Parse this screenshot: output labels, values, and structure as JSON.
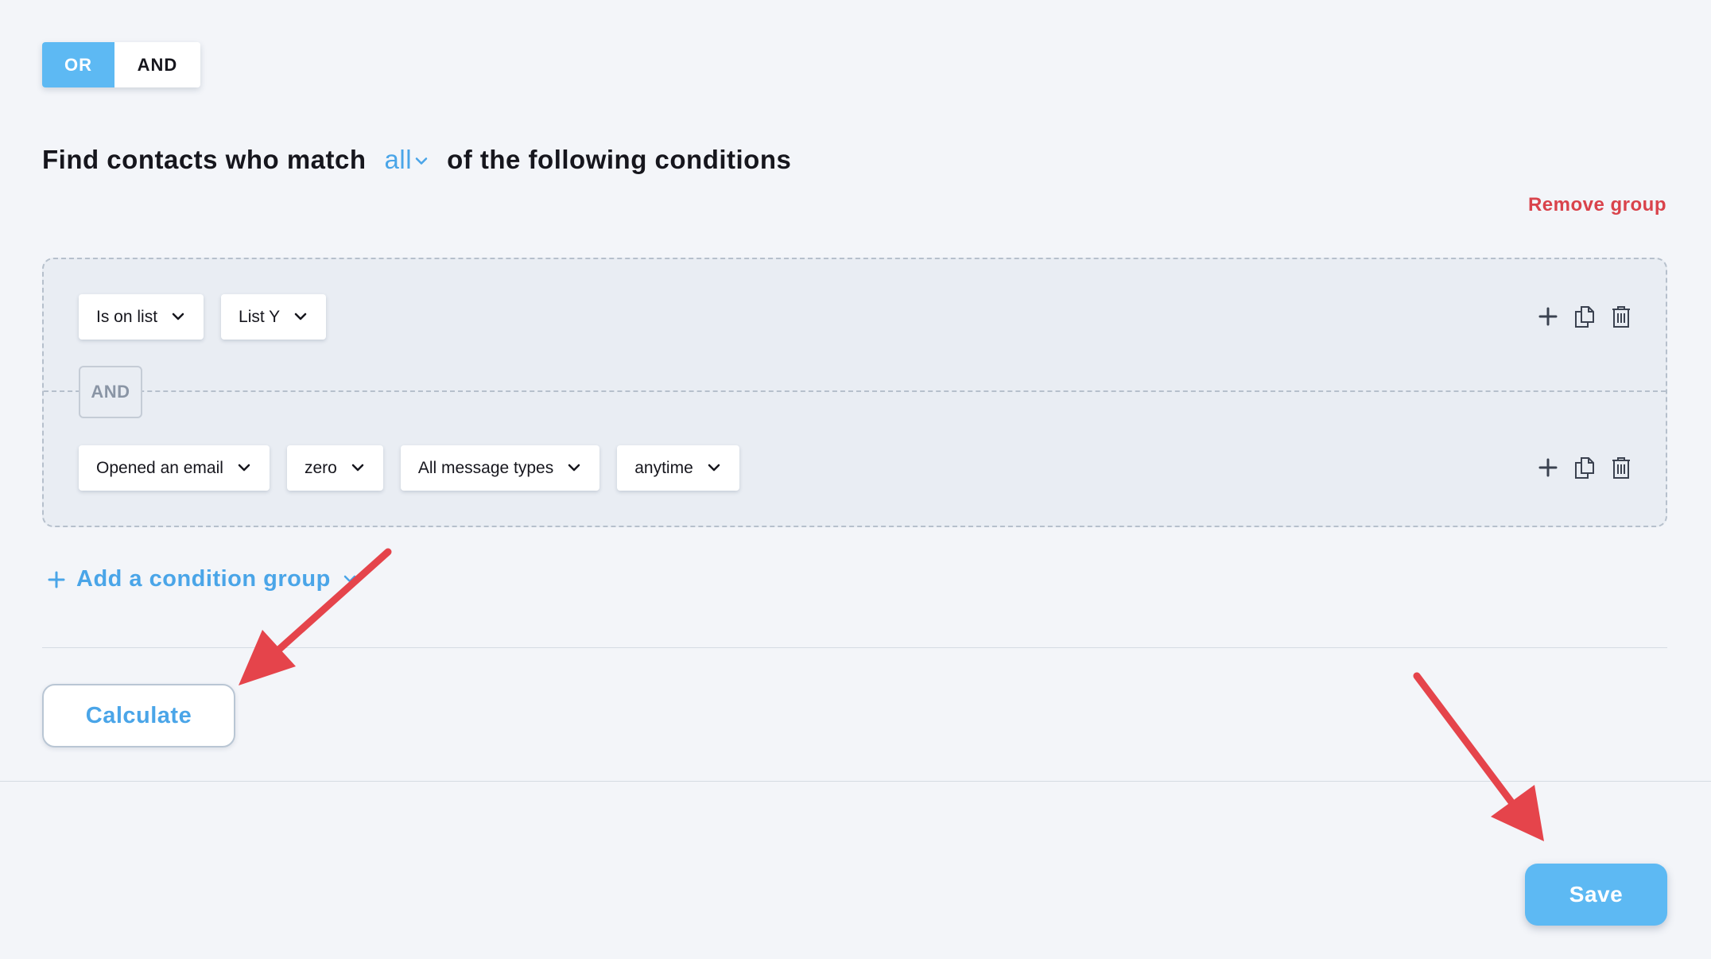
{
  "logic_toggle": {
    "or_label": "OR",
    "and_label": "AND",
    "selected": "OR"
  },
  "heading": {
    "prefix": "Find contacts who match",
    "match_value": "all",
    "suffix": "of the following conditions"
  },
  "remove_group_label": "Remove group",
  "group": {
    "row1": {
      "condition": "Is on list",
      "list": "List Y"
    },
    "connector": "AND",
    "row2": {
      "condition": "Opened an email",
      "count": "zero",
      "message_type": "All message types",
      "timeframe": "anytime"
    }
  },
  "add_condition_group_label": "Add a condition group",
  "calculate_label": "Calculate",
  "save_label": "Save",
  "colors": {
    "accent": "#5db9f3",
    "link": "#4aa5e8",
    "danger": "#d9434b",
    "annotation_arrow": "#e5444b"
  },
  "icons": [
    "chevron-down-icon",
    "plus-icon",
    "copy-icon",
    "trash-icon"
  ]
}
